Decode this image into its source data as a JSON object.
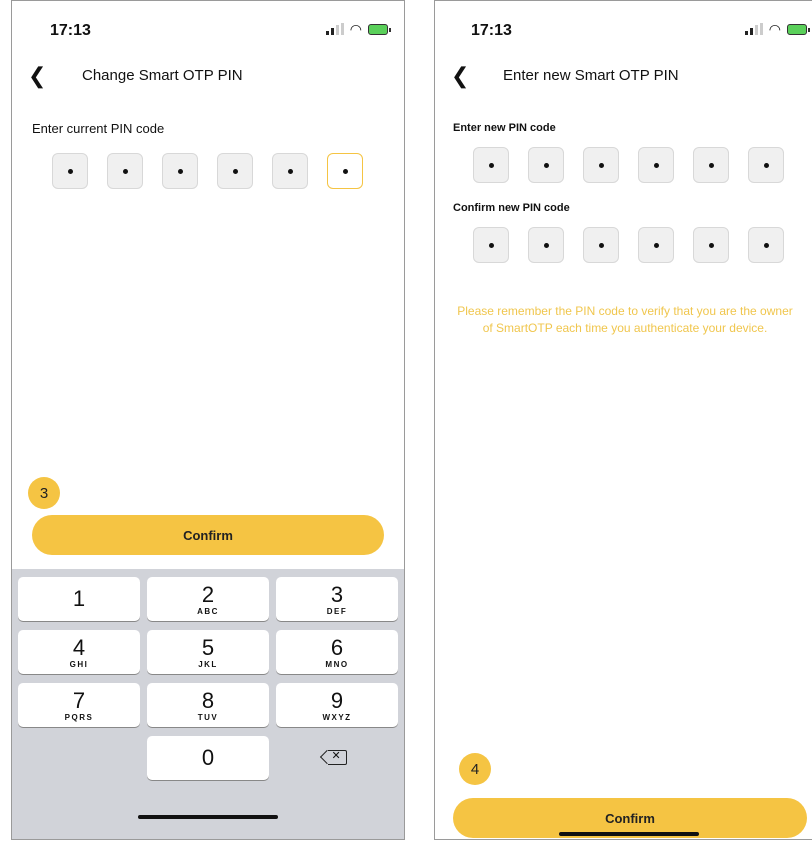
{
  "colors": {
    "accent": "#f5c443",
    "notice_text": "#f0c64d",
    "keyboard_bg": "#d1d3d9"
  },
  "left_screen": {
    "status_time": "17:13",
    "title": "Change Smart OTP PIN",
    "field_label": "Enter current PIN code",
    "pin_length": 6,
    "active_pin_index": 5,
    "step_badge": "3",
    "confirm_label": "Confirm",
    "keypad": [
      {
        "num": "1",
        "letters": ""
      },
      {
        "num": "2",
        "letters": "ABC"
      },
      {
        "num": "3",
        "letters": "DEF"
      },
      {
        "num": "4",
        "letters": "GHI"
      },
      {
        "num": "5",
        "letters": "JKL"
      },
      {
        "num": "6",
        "letters": "MNO"
      },
      {
        "num": "7",
        "letters": "PQRS"
      },
      {
        "num": "8",
        "letters": "TUV"
      },
      {
        "num": "9",
        "letters": "WXYZ"
      },
      {
        "num": "0",
        "letters": ""
      }
    ],
    "icons": [
      "back-icon",
      "signal-icon",
      "wifi-icon",
      "battery-icon",
      "delete-key-icon"
    ]
  },
  "right_screen": {
    "status_time": "17:13",
    "title": "Enter new Smart OTP PIN",
    "new_pin_label": "Enter new PIN code",
    "confirm_pin_label": "Confirm new PIN code",
    "notice": "Please remember the PIN code to verify that you are the owner of SmartOTP each time you authenticate your device.",
    "step_badge": "4",
    "confirm_label": "Confirm"
  }
}
